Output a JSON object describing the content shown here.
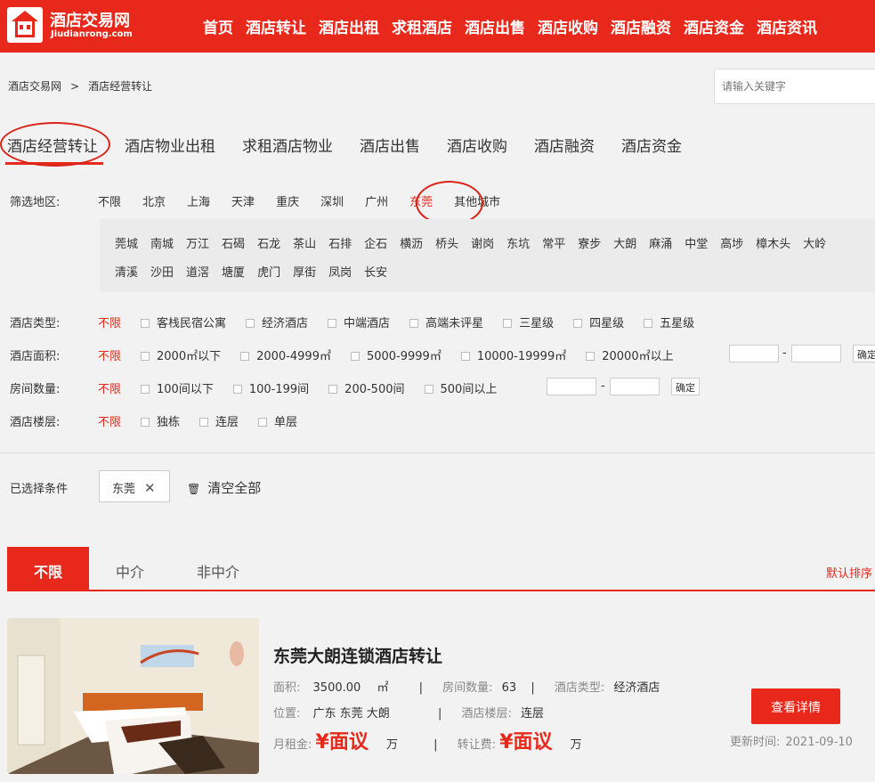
{
  "header": {
    "logo_name": "酒店交易网",
    "logo_sub": "Jiudianrong.com",
    "nav": [
      "首页",
      "酒店转让",
      "酒店出租",
      "求租酒店",
      "酒店出售",
      "酒店收购",
      "酒店融资",
      "酒店资金",
      "酒店资讯"
    ]
  },
  "breadcrumb": {
    "home": "酒店交易网",
    "sep": ">",
    "current": "酒店经营转让"
  },
  "search": {
    "placeholder": "请输入关键字"
  },
  "categories": [
    "酒店经营转让",
    "酒店物业出租",
    "求租酒店物业",
    "酒店出售",
    "酒店收购",
    "酒店融资",
    "酒店资金"
  ],
  "filters": {
    "region_label": "筛选地区:",
    "regions": [
      "不限",
      "北京",
      "上海",
      "天津",
      "重庆",
      "深圳",
      "广州",
      "东莞",
      "其他城市"
    ],
    "districts_row1": [
      "莞城",
      "南城",
      "万江",
      "石碣",
      "石龙",
      "茶山",
      "石排",
      "企石",
      "横沥",
      "桥头",
      "谢岗",
      "东坑",
      "常平",
      "寮步",
      "大朗",
      "麻涌",
      "中堂",
      "高埗",
      "樟木头",
      "大岭"
    ],
    "districts_row2": [
      "清溪",
      "沙田",
      "道滘",
      "塘厦",
      "虎门",
      "厚街",
      "凤岗",
      "长安"
    ],
    "type_label": "酒店类型:",
    "types": [
      "客栈民宿公寓",
      "经济酒店",
      "中端酒店",
      "高端未评星",
      "三星级",
      "四星级",
      "五星级"
    ],
    "area_label": "酒店面积:",
    "areas": [
      "2000㎡以下",
      "2000-4999㎡",
      "5000-9999㎡",
      "10000-19999㎡",
      "20000㎡以上"
    ],
    "rooms_label": "房间数量:",
    "rooms": [
      "100间以下",
      "100-199间",
      "200-500间",
      "500间以上"
    ],
    "floor_label": "酒店楼层:",
    "floors": [
      "独栋",
      "连层",
      "单层"
    ],
    "unlimited": "不限",
    "confirm": "确定",
    "dash": "-"
  },
  "selected": {
    "label": "已选择条件",
    "chip": "东莞",
    "chip_close": "✕",
    "clear": "清空全部",
    "clear_icon": "🗑"
  },
  "tabs": [
    "不限",
    "中介",
    "非中介"
  ],
  "sort": "默认排序",
  "listing": {
    "title": "东莞大朗连锁酒店转让",
    "area_label": "面积:",
    "area_value": "3500.00",
    "area_unit": "㎡",
    "rooms_label": "房间数量:",
    "rooms_value": "63",
    "type_label": "酒店类型:",
    "type_value": "经济酒店",
    "loc_label": "位置:",
    "loc_value": "广东 东莞 大朗",
    "floor_label": "酒店楼层:",
    "floor_value": "连层",
    "rent_label": "月租金:",
    "rent_value": "¥面议",
    "rent_unit": "万",
    "fee_label": "转让费:",
    "fee_value": "¥面议",
    "fee_unit": "万",
    "sep": "|",
    "detail_button": "查看详情",
    "update_label": "更新时间:",
    "update_value": "2021-09-10"
  },
  "colors": {
    "brand": "#e8281a"
  }
}
